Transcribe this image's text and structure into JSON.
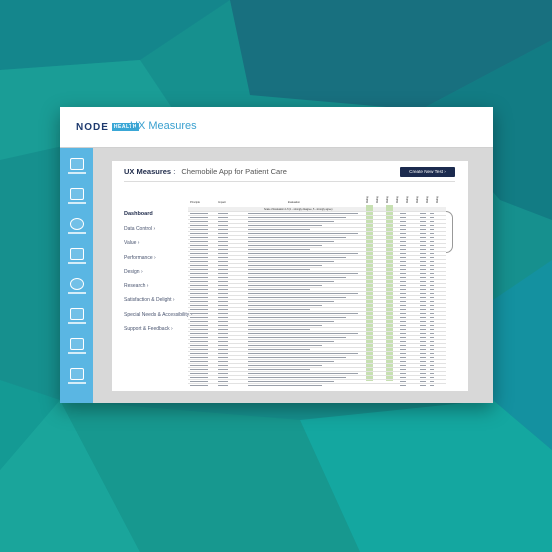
{
  "colors": {
    "background": "#16908e",
    "sidebar": "#5ab6e3",
    "brand_blue": "#3aa0cf",
    "button": "#1b2a4e",
    "highlight_col": "#c7e0b2"
  },
  "header": {
    "logo_text": "NODE",
    "logo_badge": "HEALTH",
    "app_title": "UX Measures"
  },
  "sidebar": {
    "items": [
      {
        "icon": "chart-icon"
      },
      {
        "icon": "list-icon"
      },
      {
        "icon": "gear-icon"
      },
      {
        "icon": "users-icon"
      },
      {
        "icon": "people-icon"
      },
      {
        "icon": "building-icon"
      },
      {
        "icon": "briefcase-icon"
      },
      {
        "icon": "monitor-icon"
      }
    ]
  },
  "page": {
    "title": "UX Measures",
    "separator": ":",
    "subtitle": "Chemobile App for Patient Care",
    "create_button": "Create New Test  ›",
    "dashboard": "Dashboard",
    "nav": [
      "Data Control ›",
      "Value ›",
      "Performance ›",
      "Design ›",
      "Research ›",
      "Satisfaction & Delight ›",
      "Special Needs & Accessibility ›",
      "Support & Feedback ›"
    ]
  },
  "table": {
    "headers": {
      "principle": "Principle",
      "impact": "Impact",
      "evaluation": "Evaluation"
    },
    "band": "Scale of Evaluation 1-5 (1 - strongly disagree, 5 - strongly agree)"
  }
}
